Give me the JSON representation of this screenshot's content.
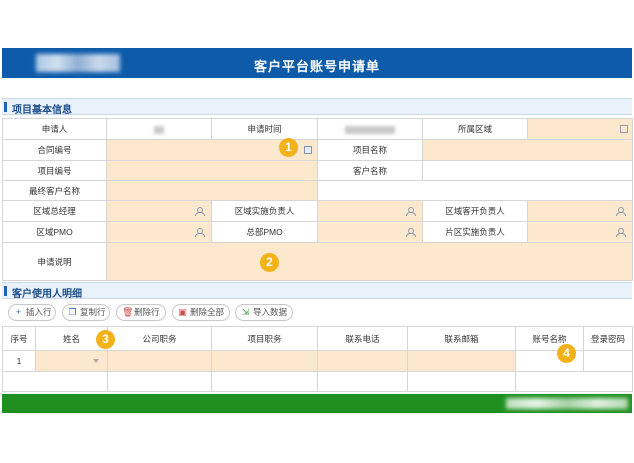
{
  "header": {
    "title": "客户平台账号申请单"
  },
  "section1": {
    "title": "项目基本信息"
  },
  "basic_info": {
    "applicant_label": "申请人",
    "apply_time_label": "申请时间",
    "region_label": "所属区域",
    "contract_no_label": "合同编号",
    "project_name_label": "项目名称",
    "project_no_label": "项目编号",
    "customer_name_label": "客户名称",
    "final_customer_label": "最终客户名称",
    "regional_gm_label": "区域总经理",
    "regional_impl_label": "区域实施负责人",
    "regional_dev_label": "区域客开负责人",
    "regional_pmo_label": "区域PMO",
    "hq_pmo_label": "总部PMO",
    "area_impl_label": "片区实施负责人",
    "description_label": "申请说明"
  },
  "section2": {
    "title": "客户使用人明细"
  },
  "toolbar": {
    "insert_label": "插入行",
    "copy_label": "复制行",
    "delete_label": "删除行",
    "delete_all_label": "删除全部",
    "import_label": "导入数据"
  },
  "detail_table": {
    "headers": [
      "序号",
      "姓名",
      "公司职务",
      "项目职务",
      "联系电话",
      "联系邮箱",
      "账号名称",
      "登录密码"
    ],
    "rows": [
      {
        "index": "1"
      }
    ]
  },
  "badges": [
    "1",
    "2",
    "3",
    "4"
  ],
  "colors": {
    "header": "#0e5ba9",
    "input_fill": "#fce8cc",
    "badge": "#f3b11a",
    "footer": "#1f8f1f"
  }
}
